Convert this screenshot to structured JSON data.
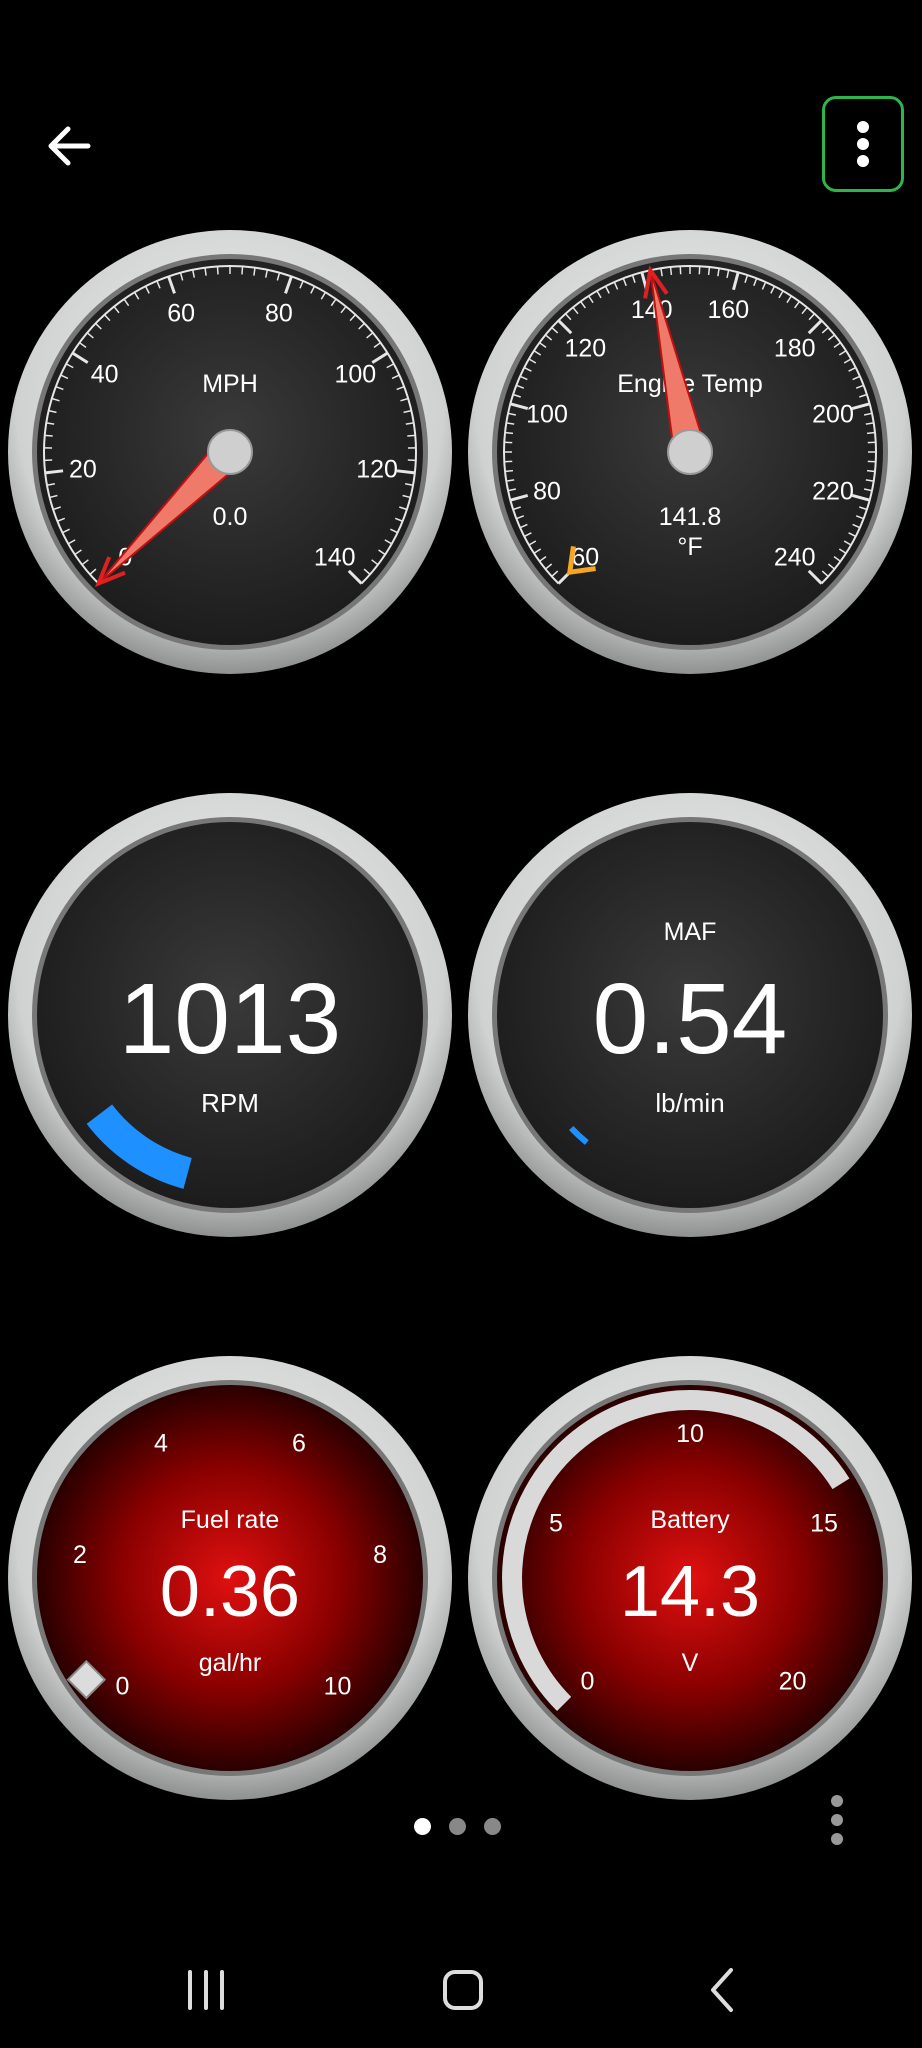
{
  "colors": {
    "accent_blue": "#1e90ff",
    "needle_red": "#e02020",
    "warn_orange": "#f5a623",
    "frame_green": "#2db54b"
  },
  "toolbar": {
    "back_icon": "arrow-left-icon",
    "menu_icon": "more-vertical-icon"
  },
  "gauges": {
    "speed": {
      "label": "MPH",
      "value": "0.0",
      "ticks": [
        "0",
        "20",
        "40",
        "60",
        "80",
        "100",
        "120",
        "140"
      ],
      "needle_value": 0,
      "min": 0,
      "max": 140
    },
    "temp": {
      "label": "Engine Temp",
      "value": "141.8",
      "unit": "°F",
      "ticks": [
        "60",
        "80",
        "100",
        "120",
        "140",
        "160",
        "180",
        "200",
        "220",
        "240"
      ],
      "needle_value": 141.8,
      "min": 60,
      "max": 240,
      "marker_value": 60
    },
    "rpm": {
      "label": "RPM",
      "value": "1013",
      "fill_fraction": 0.14
    },
    "maf": {
      "label": "MAF",
      "value": "0.54",
      "unit": "lb/min",
      "fill_fraction": 0.02
    },
    "fuel": {
      "label": "Fuel rate",
      "value": "0.36",
      "unit": "gal/hr",
      "ticks": [
        "0",
        "2",
        "4",
        "6",
        "8",
        "10"
      ],
      "marker_value": 0.36,
      "min": 0,
      "max": 10
    },
    "battery": {
      "label": "Battery",
      "value": "14.3",
      "unit": "V",
      "ticks": [
        "0",
        "5",
        "10",
        "15",
        "20"
      ],
      "fill_value": 14.3,
      "min": 0,
      "max": 20
    }
  },
  "pager": {
    "pages": 3,
    "active": 0
  },
  "navbar": {
    "recents_icon": "recents-icon",
    "home_icon": "home-icon",
    "back_icon": "chevron-left-icon"
  }
}
